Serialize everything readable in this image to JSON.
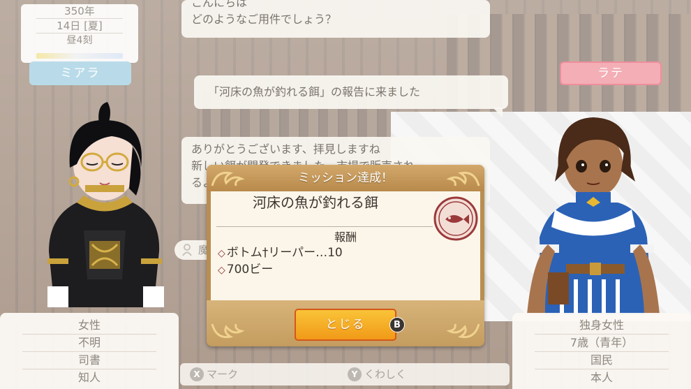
{
  "date": {
    "year": "350年",
    "day": "14日 [夏]",
    "time": "昼4刻"
  },
  "names": {
    "left": "ミアラ",
    "right": "ラテ"
  },
  "dialogue": {
    "line1": [
      "こんにちは",
      "どのようなご用件でしょう？"
    ],
    "line2": "「河床の魚が釣れる餌」の報告に来ました",
    "line3": [
      "ありがとうございます、拝見しますね",
      "新しい餌が開発できました。市場で販売され",
      "るよ"
    ],
    "speaker_small": "魔"
  },
  "dialog": {
    "header": "ミッション達成！",
    "mission_title": "河床の魚が釣れる餌",
    "reward_heading": "報酬",
    "rewards": [
      "ボトム†リーパー…10",
      "700ビー"
    ],
    "close_label": "とじる",
    "close_key": "B"
  },
  "info_left": [
    "女性",
    "不明",
    "司書",
    "知人"
  ],
  "info_right": [
    "独身女性",
    "7歳（青年）",
    "国民",
    "本人"
  ],
  "hints": {
    "x_key": "X",
    "x_label": "マーク",
    "y_key": "Y",
    "y_label": "くわしく"
  },
  "colors": {
    "accent_button": "#f5ad25",
    "dialog_frame": "#b98e52",
    "name_left_bg": "#b9dbe9",
    "name_right_bg": "#f3aeb6"
  }
}
